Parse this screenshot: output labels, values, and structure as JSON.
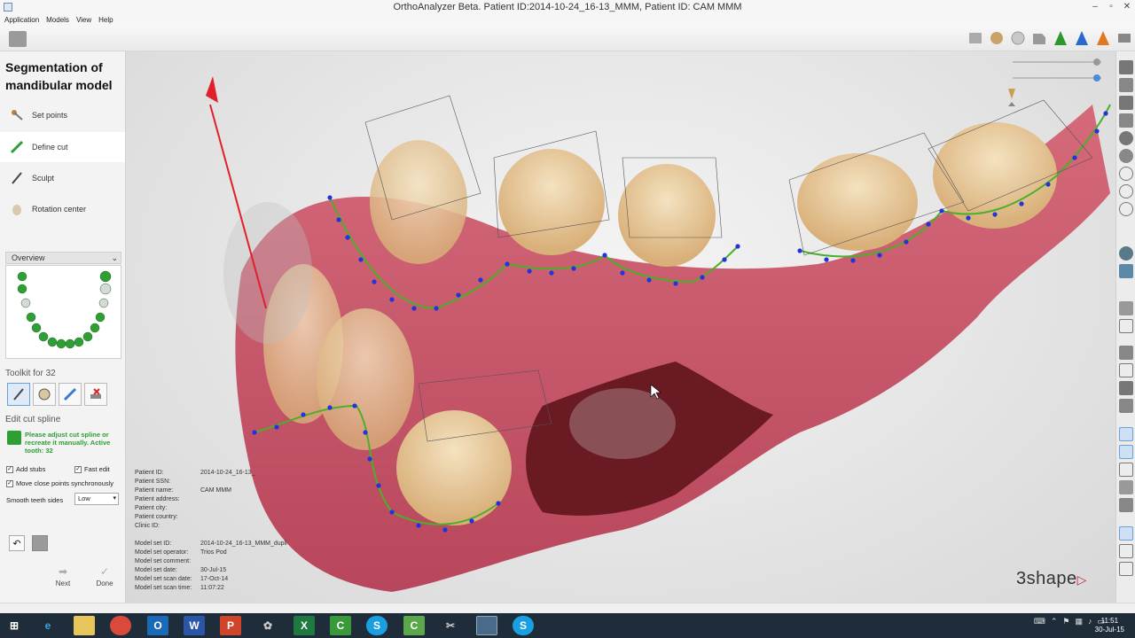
{
  "window": {
    "title": "OrthoAnalyzer Beta. Patient ID:2014-10-24_16-13_MMM, Patient ID: CAM MMM"
  },
  "menu": [
    "Application",
    "Models",
    "View",
    "Help"
  ],
  "panel": {
    "title_line1": "Segmentation of",
    "title_line2": "mandibular model",
    "steps": [
      {
        "label": "Set points",
        "icon": "set-points-icon"
      },
      {
        "label": "Define cut",
        "icon": "define-cut-icon"
      },
      {
        "label": "Sculpt",
        "icon": "sculpt-icon"
      },
      {
        "label": "Rotation center",
        "icon": "rotation-center-icon"
      }
    ],
    "overview_label": "Overview",
    "toolkit_label": "Toolkit for 32",
    "edit_label": "Edit cut spline",
    "message": "Please adjust cut spline or recreate it manually. Active tooth: 32",
    "checkboxes": {
      "add_stubs": "Add stubs",
      "fast_edit": "Fast edit",
      "move_close": "Move close points synchronously"
    },
    "smooth_label": "Smooth teeth sides",
    "smooth_value": "Low",
    "next_label": "Next",
    "done_label": "Done"
  },
  "info": {
    "patient": [
      {
        "k": "Patient ID:",
        "v": "2014-10-24_16-13_"
      },
      {
        "k": "Patient SSN:",
        "v": ""
      },
      {
        "k": "Patient name:",
        "v": "CAM MMM"
      },
      {
        "k": "Patient address:",
        "v": ""
      },
      {
        "k": "Patient city:",
        "v": ""
      },
      {
        "k": "Patient country:",
        "v": ""
      },
      {
        "k": "Clinic ID:",
        "v": ""
      }
    ],
    "model": [
      {
        "k": "Model set ID:",
        "v": "2014-10-24_16-13_MMM_dupli"
      },
      {
        "k": "Model set operator:",
        "v": "Trios Pod"
      },
      {
        "k": "Model set comment:",
        "v": ""
      },
      {
        "k": "Model set date:",
        "v": "30-Jul-15"
      },
      {
        "k": "Model set scan date:",
        "v": "17-Oct-14"
      },
      {
        "k": "Model set scan time:",
        "v": "11:07:22"
      }
    ]
  },
  "logo_text": "3shape",
  "clock": {
    "time": "11:51",
    "date": "30-Jul-15"
  },
  "colors": {
    "spline": "#4caf2a",
    "points": "#2233dd",
    "gum": "#c8546a",
    "tooth": "#e6c89a",
    "axis": "#e0202a"
  }
}
